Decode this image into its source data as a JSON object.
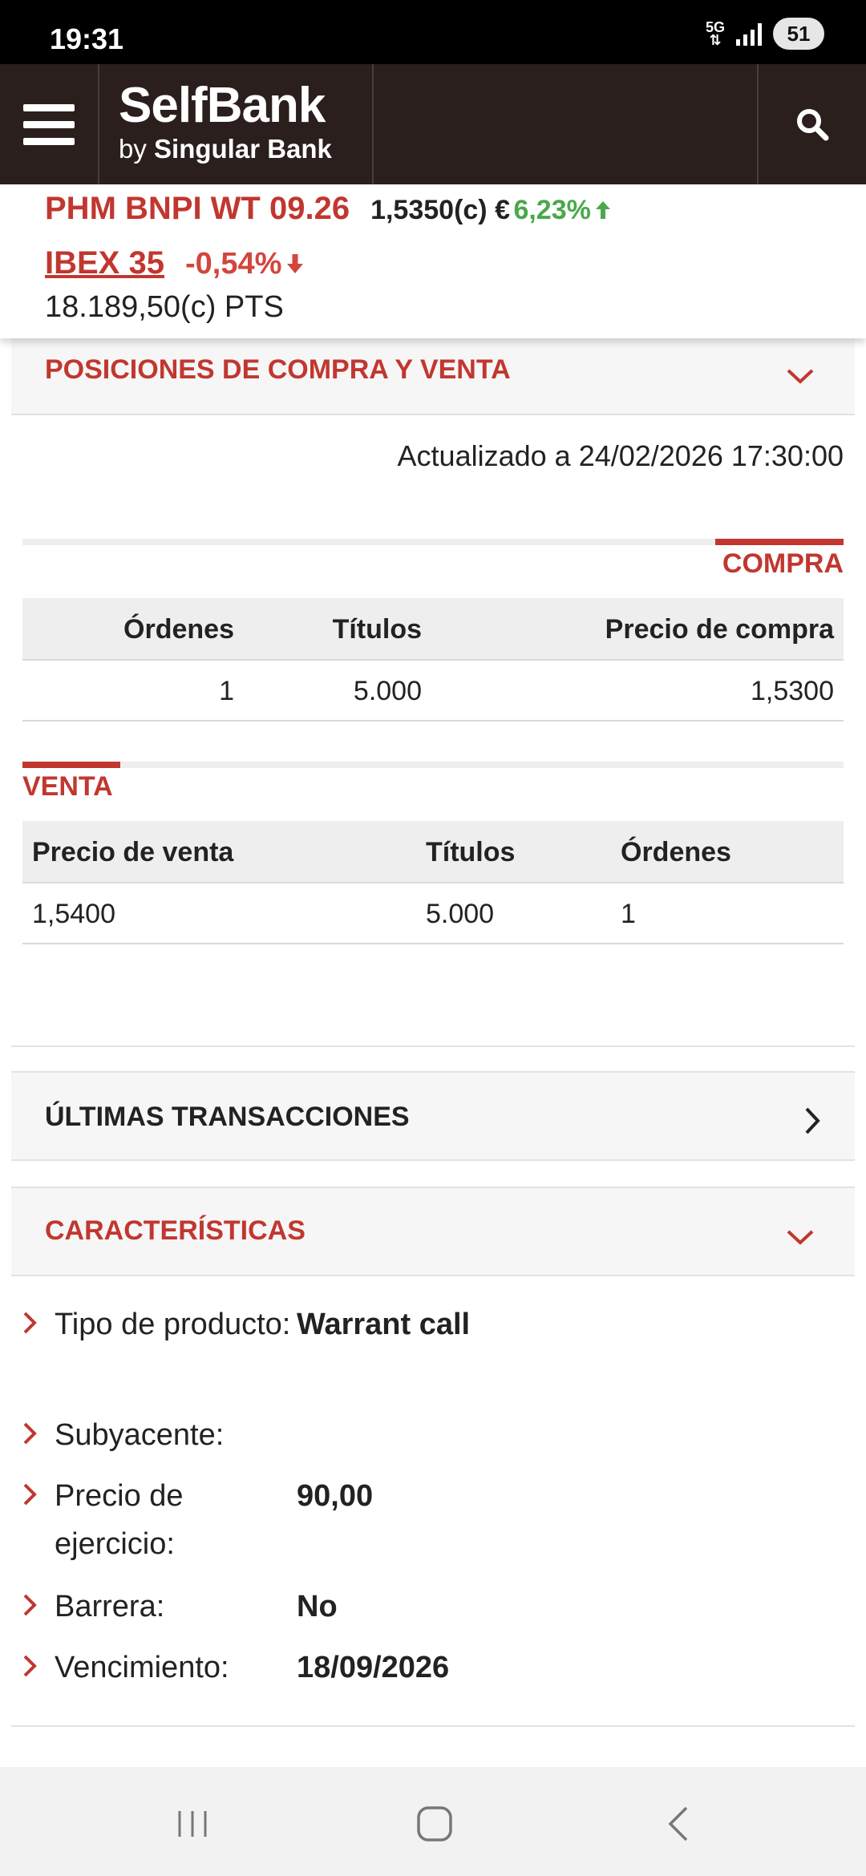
{
  "status_bar": {
    "time": "19:31",
    "network": "5G",
    "battery": "51"
  },
  "header": {
    "logo": {
      "title": "SelfBank",
      "subtitle_prefix": "by",
      "subtitle_brand": "Singular Bank"
    }
  },
  "ticker": {
    "product_name": "PHM BNPI WT 09.26",
    "product_price": "1,5350(c) €",
    "product_change": "6,23%",
    "index_name": "IBEX 35",
    "index_change": "-0,54%",
    "index_value": "18.189,50(c) PTS"
  },
  "positions": {
    "title": "POSICIONES DE COMPRA Y VENTA",
    "updated": "Actualizado a 24/02/2026 17:30:00",
    "buy": {
      "label": "COMPRA",
      "headers": [
        "Órdenes",
        "Títulos",
        "Precio de compra"
      ],
      "rows": [
        [
          "1",
          "5.000",
          "1,5300"
        ]
      ]
    },
    "sell": {
      "label": "VENTA",
      "headers": [
        "Precio de venta",
        "Títulos",
        "Órdenes"
      ],
      "rows": [
        [
          "1,5400",
          "5.000",
          "1"
        ]
      ]
    }
  },
  "transactions": {
    "title": "ÚLTIMAS TRANSACCIONES"
  },
  "characteristics": {
    "title": "CARACTERÍSTICAS",
    "items": [
      {
        "label": "Tipo de producto:",
        "value": "Warrant call"
      },
      {
        "label": "Subyacente:",
        "value": ""
      },
      {
        "label": "Precio de ejercicio:",
        "value": "90,00"
      },
      {
        "label": "Barrera:",
        "value": "No"
      },
      {
        "label": "Vencimiento:",
        "value": "18/09/2026"
      }
    ]
  },
  "colors": {
    "brand_red": "#c1372f",
    "header_bg": "#2a1f1c",
    "positive": "#4aa84a",
    "negative": "#d2463d"
  },
  "icons": [
    "menu-icon",
    "search-icon",
    "arrow-up-icon",
    "arrow-down-icon",
    "chevron-down-icon",
    "chevron-right-icon",
    "recents-icon",
    "home-icon",
    "back-icon"
  ]
}
